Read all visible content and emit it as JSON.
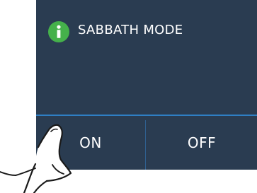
{
  "dialog": {
    "title": "SABBATH MODE",
    "icon": "info-icon",
    "colors": {
      "panel": "#2a3c51",
      "accent_line": "#2f7fc4",
      "icon_bg": "#45b14b",
      "text": "#ffffff"
    }
  },
  "buttons": {
    "on_label": "ON",
    "off_label": "OFF"
  },
  "overlay": {
    "icon": "pointing-hand-icon"
  }
}
